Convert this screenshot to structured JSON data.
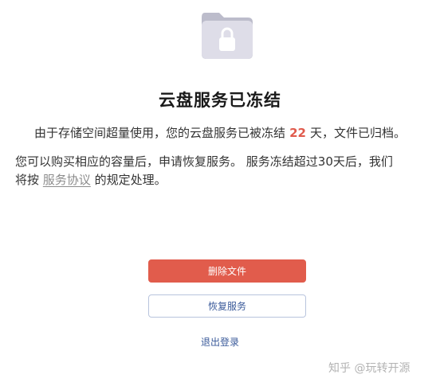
{
  "icon": {
    "name": "folder-lock-icon"
  },
  "title": "云盘服务已冻结",
  "status": {
    "prefix": "由于存储空间超量使用，您的云盘服务已被冻结",
    "days": "22",
    "suffix": "天，文件已归档。"
  },
  "explanation": {
    "line1": "您可以购买相应的容量后，申请恢复服务。 服务冻结超过30天后，我们",
    "line2_prefix": "将按",
    "agreement_link": "服务协议",
    "line2_suffix": "的规定处理。"
  },
  "buttons": {
    "delete_label": "删除文件",
    "restore_label": "恢复服务"
  },
  "logout_label": "退出登录",
  "watermark": "知乎 @玩转开源",
  "colors": {
    "accent_red": "#e15c4c",
    "link_blue": "#3a5a9a"
  }
}
